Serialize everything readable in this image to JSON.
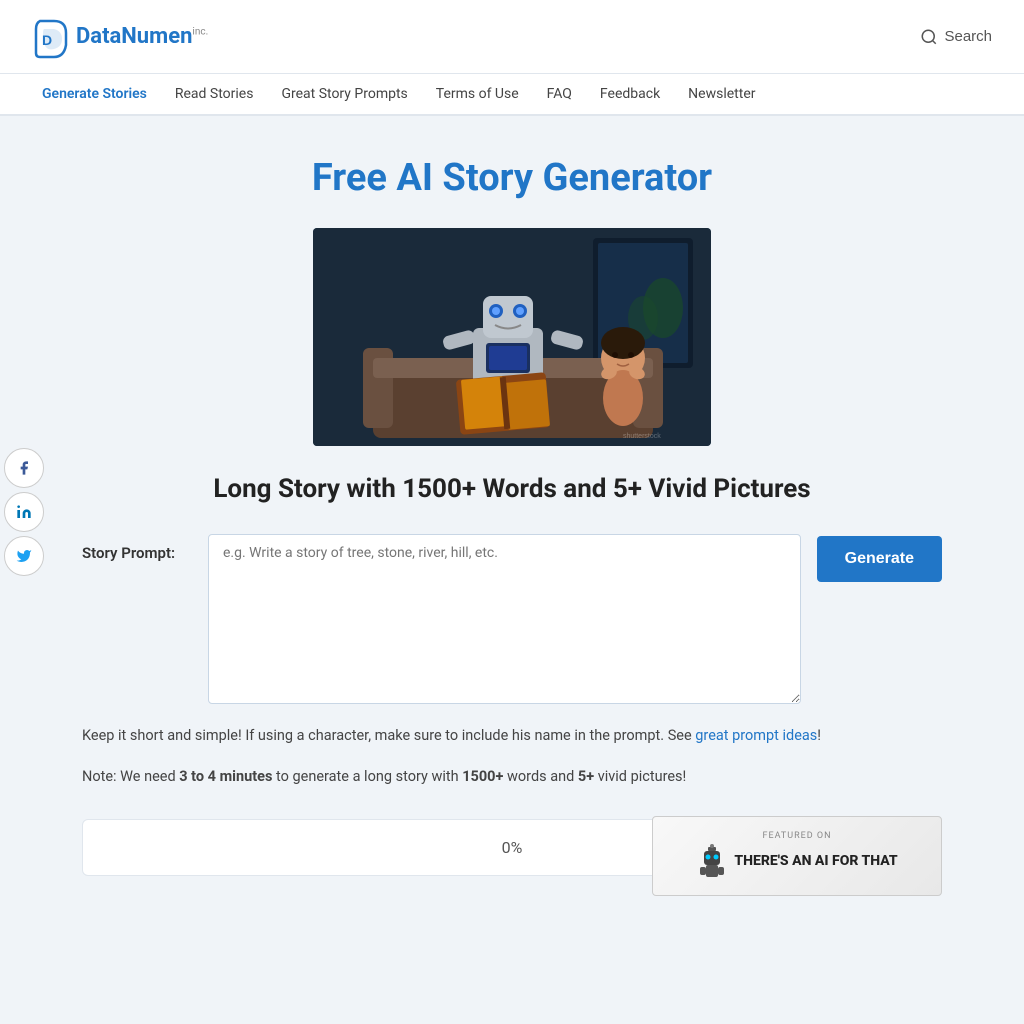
{
  "header": {
    "logo_text": "DataNumen",
    "logo_inc": "inc.",
    "search_label": "Search"
  },
  "nav": {
    "items": [
      {
        "label": "Generate Stories",
        "active": true,
        "href": "#"
      },
      {
        "label": "Read Stories",
        "active": false,
        "href": "#"
      },
      {
        "label": "Great Story Prompts",
        "active": false,
        "href": "#"
      },
      {
        "label": "Terms of Use",
        "active": false,
        "href": "#"
      },
      {
        "label": "FAQ",
        "active": false,
        "href": "#"
      },
      {
        "label": "Feedback",
        "active": false,
        "href": "#"
      },
      {
        "label": "Newsletter",
        "active": false,
        "href": "#"
      }
    ]
  },
  "main": {
    "page_title": "Free AI Story Generator",
    "subtitle": "Long Story with 1500+ Words and 5+ Vivid Pictures",
    "form_label": "Story Prompt:",
    "textarea_placeholder": "e.g. Write a story of tree, stone, river, hill, etc.",
    "generate_button": "Generate",
    "hint_text_1": "Keep it short and simple! If using a character, make sure to include his name in the prompt. See ",
    "hint_link": "great prompt ideas",
    "hint_text_2": "!",
    "note_prefix": "Note: We need ",
    "note_time": "3 to 4 minutes",
    "note_mid": " to generate a long story with ",
    "note_words": "1500+",
    "note_mid2": " words and ",
    "note_pics": "5+",
    "note_suffix": " vivid pictures!",
    "progress_label": "0%"
  },
  "social": {
    "facebook_icon": "f",
    "linkedin_icon": "in",
    "twitter_icon": "t"
  },
  "badge": {
    "featured_on": "FEATURED ON",
    "name": "THERE'S AN AI FOR THAT"
  }
}
